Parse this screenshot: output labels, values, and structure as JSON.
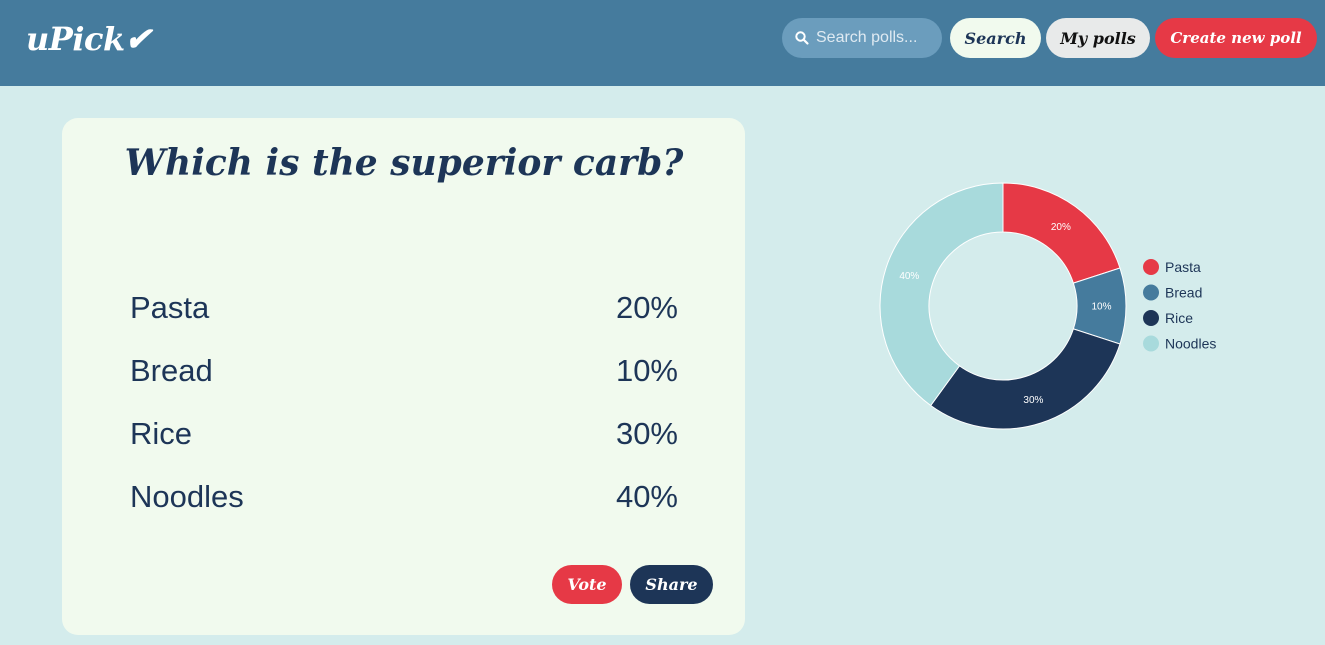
{
  "header": {
    "logo": "uPick✔",
    "search_placeholder": "Search polls...",
    "search_button": "Search",
    "my_polls_button": "My polls",
    "create_button": "Create new poll",
    "colors": {
      "bar": "#457b9d",
      "primary": "#e63946",
      "dark": "#1d3557"
    }
  },
  "poll": {
    "title": "Which is the superior carb?",
    "options": [
      {
        "label": "Pasta",
        "percent": "20%"
      },
      {
        "label": "Bread",
        "percent": "10%"
      },
      {
        "label": "Rice",
        "percent": "30%"
      },
      {
        "label": "Noodles",
        "percent": "40%"
      }
    ],
    "vote_button": "Vote",
    "share_button": "Share"
  },
  "chart_data": {
    "type": "pie",
    "variant": "donut",
    "categories": [
      "Pasta",
      "Bread",
      "Rice",
      "Noodles"
    ],
    "values": [
      20,
      10,
      30,
      40
    ],
    "labels": [
      "20%",
      "10%",
      "30%",
      "40%"
    ],
    "colors": [
      "#e63946",
      "#457b9d",
      "#1d3557",
      "#a8dadc"
    ],
    "legend": "right"
  }
}
